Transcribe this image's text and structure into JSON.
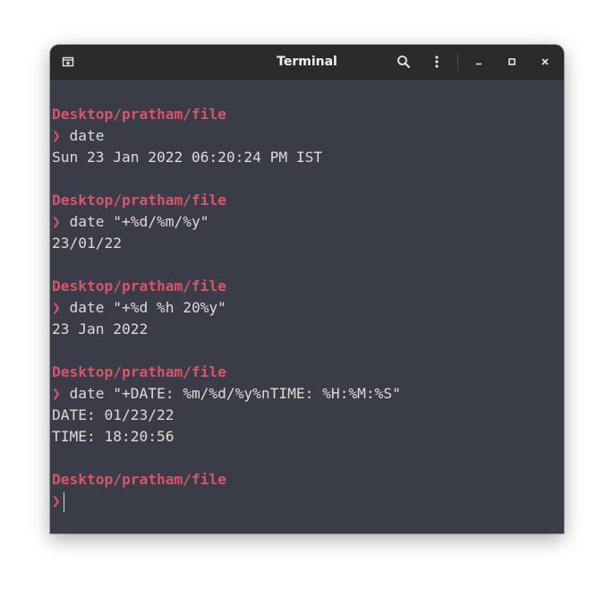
{
  "window": {
    "title": "Terminal",
    "icons": {
      "new_tab": "new-tab-icon",
      "search": "search-icon",
      "menu": "kebab-menu-icon",
      "minimize": "minimize-icon",
      "maximize": "maximize-icon",
      "close": "close-icon"
    }
  },
  "colors": {
    "terminal_bg": "#3a3d47",
    "titlebar_bg": "#2b2b2b",
    "prompt": "#d5566a",
    "text": "#e3d6d6"
  },
  "terminal": {
    "prompt_symbol": "❯",
    "blocks": [
      {
        "path": "Desktop/pratham/file",
        "command": "date",
        "output": [
          "Sun 23 Jan 2022 06:20:24 PM IST"
        ]
      },
      {
        "path": "Desktop/pratham/file",
        "command": "date \"+%d/%m/%y\"",
        "output": [
          "23/01/22"
        ]
      },
      {
        "path": "Desktop/pratham/file",
        "command": "date \"+%d %h 20%y\"",
        "output": [
          "23 Jan 2022"
        ]
      },
      {
        "path": "Desktop/pratham/file",
        "command": "date \"+DATE: %m/%d/%y%nTIME: %H:%M:%S\"",
        "output": [
          "DATE: 01/23/22",
          "TIME: 18:20:56"
        ]
      }
    ],
    "current_path": "Desktop/pratham/file"
  }
}
